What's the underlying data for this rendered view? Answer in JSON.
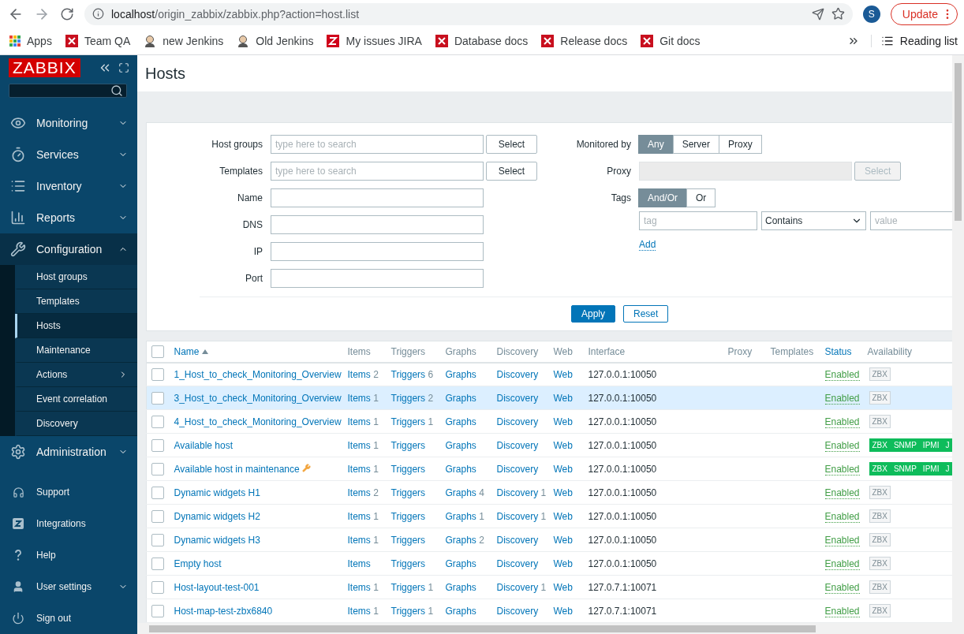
{
  "browser": {
    "url_host": "localhost",
    "url_path": "/origin_zabbix/zabbix.php?action=host.list",
    "profile": "S",
    "update": "Update",
    "bookmarks": [
      {
        "label": "Apps",
        "kind": "apps"
      },
      {
        "label": "Team QA",
        "kind": "doc"
      },
      {
        "label": "new Jenkins",
        "kind": "person"
      },
      {
        "label": "Old Jenkins",
        "kind": "person"
      },
      {
        "label": "My issues JIRA",
        "kind": "jira"
      },
      {
        "label": "Database docs",
        "kind": "doc"
      },
      {
        "label": "Release docs",
        "kind": "doc"
      },
      {
        "label": "Git docs",
        "kind": "doc"
      }
    ],
    "reading_list": "Reading list"
  },
  "sidebar": {
    "logo": "ZABBIX",
    "menu": [
      {
        "label": "Monitoring",
        "expanded": false
      },
      {
        "label": "Services",
        "expanded": false
      },
      {
        "label": "Inventory",
        "expanded": false
      },
      {
        "label": "Reports",
        "expanded": false
      },
      {
        "label": "Configuration",
        "expanded": true,
        "children": [
          {
            "label": "Host groups",
            "selected": false
          },
          {
            "label": "Templates",
            "selected": false
          },
          {
            "label": "Hosts",
            "selected": true
          },
          {
            "label": "Maintenance",
            "selected": false
          },
          {
            "label": "Actions",
            "selected": false,
            "expanded": false
          },
          {
            "label": "Event correlation",
            "selected": false
          },
          {
            "label": "Discovery",
            "selected": false
          }
        ]
      },
      {
        "label": "Administration",
        "expanded": false
      }
    ],
    "footer": [
      {
        "label": "Support"
      },
      {
        "label": "Integrations"
      },
      {
        "label": "Help"
      },
      {
        "label": "User settings",
        "expanded": false
      },
      {
        "label": "Sign out"
      }
    ]
  },
  "page": {
    "title": "Hosts"
  },
  "filter": {
    "fields": [
      {
        "label": "Host groups",
        "kind": "multiselect",
        "placeholder": "type here to search",
        "button": "Select"
      },
      {
        "label": "Templates",
        "kind": "multiselect",
        "placeholder": "type here to search",
        "button": "Select"
      },
      {
        "label": "Name",
        "kind": "text"
      },
      {
        "label": "DNS",
        "kind": "text"
      },
      {
        "label": "IP",
        "kind": "text"
      },
      {
        "label": "Port",
        "kind": "text"
      }
    ],
    "monitored_by": {
      "label": "Monitored by",
      "options": [
        {
          "label": "Any",
          "selected": true
        },
        {
          "label": "Server",
          "selected": false
        },
        {
          "label": "Proxy",
          "selected": false
        }
      ]
    },
    "proxy": {
      "label": "Proxy",
      "button": "Select",
      "disabled": true
    },
    "tags": {
      "label": "Tags",
      "options": [
        {
          "label": "And/Or",
          "selected": true
        },
        {
          "label": "Or",
          "selected": false
        }
      ],
      "tag_placeholder": "tag",
      "operator": "Contains",
      "value_placeholder": "value",
      "add": "Add"
    },
    "apply": "Apply",
    "reset": "Reset"
  },
  "table": {
    "select_all": {
      "checked": false
    },
    "columns": [
      {
        "label": "Name",
        "sortable": true,
        "sorted": true
      },
      {
        "label": "Items",
        "sortable": false
      },
      {
        "label": "Triggers",
        "sortable": false
      },
      {
        "label": "Graphs",
        "sortable": false
      },
      {
        "label": "Discovery",
        "sortable": false
      },
      {
        "label": "Web",
        "sortable": false
      },
      {
        "label": "Interface",
        "sortable": false
      },
      {
        "label": "Proxy",
        "sortable": false
      },
      {
        "label": "Templates",
        "sortable": false
      },
      {
        "label": "Status",
        "sortable": true
      },
      {
        "label": "Availability",
        "sortable": false
      }
    ],
    "rows": [
      {
        "checked": false,
        "hovered": false,
        "name": "1_Host_to_check_Monitoring_Overview",
        "maintenance": false,
        "items": {
          "label": "Items",
          "count": "2"
        },
        "triggers": {
          "label": "Triggers",
          "count": "6"
        },
        "graphs": {
          "label": "Graphs"
        },
        "discovery": {
          "label": "Discovery"
        },
        "web": "Web",
        "interface": "127.0.0.1:10050",
        "status": "Enabled",
        "availability": [
          {
            "label": "ZBX",
            "available": false
          }
        ]
      },
      {
        "checked": false,
        "hovered": true,
        "name": "3_Host_to_check_Monitoring_Overview",
        "maintenance": false,
        "items": {
          "label": "Items",
          "count": "1"
        },
        "triggers": {
          "label": "Triggers",
          "count": "2"
        },
        "graphs": {
          "label": "Graphs"
        },
        "discovery": {
          "label": "Discovery"
        },
        "web": "Web",
        "interface": "127.0.0.1:10050",
        "status": "Enabled",
        "availability": [
          {
            "label": "ZBX",
            "available": false
          }
        ]
      },
      {
        "checked": false,
        "hovered": false,
        "name": "4_Host_to_check_Monitoring_Overview",
        "maintenance": false,
        "items": {
          "label": "Items",
          "count": "1"
        },
        "triggers": {
          "label": "Triggers",
          "count": "1"
        },
        "graphs": {
          "label": "Graphs"
        },
        "discovery": {
          "label": "Discovery"
        },
        "web": "Web",
        "interface": "127.0.0.1:10050",
        "status": "Enabled",
        "availability": [
          {
            "label": "ZBX",
            "available": false
          }
        ]
      },
      {
        "checked": false,
        "hovered": false,
        "name": "Available host",
        "maintenance": false,
        "items": {
          "label": "Items",
          "count": "1"
        },
        "triggers": {
          "label": "Triggers"
        },
        "graphs": {
          "label": "Graphs"
        },
        "discovery": {
          "label": "Discovery"
        },
        "web": "Web",
        "interface": "127.0.0.1:10050",
        "status": "Enabled",
        "availability": [
          {
            "label": "ZBX",
            "available": true
          },
          {
            "label": "SNMP",
            "available": true
          },
          {
            "label": "IPMI",
            "available": true
          },
          {
            "label": "J",
            "available": true
          }
        ]
      },
      {
        "checked": false,
        "hovered": false,
        "name": "Available host in maintenance",
        "maintenance": true,
        "items": {
          "label": "Items",
          "count": "1"
        },
        "triggers": {
          "label": "Triggers"
        },
        "graphs": {
          "label": "Graphs"
        },
        "discovery": {
          "label": "Discovery"
        },
        "web": "Web",
        "interface": "127.0.0.1:10050",
        "status": "Enabled",
        "availability": [
          {
            "label": "ZBX",
            "available": true
          },
          {
            "label": "SNMP",
            "available": true
          },
          {
            "label": "IPMI",
            "available": true
          },
          {
            "label": "J",
            "available": true
          }
        ]
      },
      {
        "checked": false,
        "hovered": false,
        "name": "Dynamic widgets H1",
        "maintenance": false,
        "items": {
          "label": "Items",
          "count": "2"
        },
        "triggers": {
          "label": "Triggers"
        },
        "graphs": {
          "label": "Graphs",
          "count": "4"
        },
        "discovery": {
          "label": "Discovery",
          "count": "1"
        },
        "web": "Web",
        "interface": "127.0.0.1:10050",
        "status": "Enabled",
        "availability": [
          {
            "label": "ZBX",
            "available": false
          }
        ]
      },
      {
        "checked": false,
        "hovered": false,
        "name": "Dynamic widgets H2",
        "maintenance": false,
        "items": {
          "label": "Items",
          "count": "1"
        },
        "triggers": {
          "label": "Triggers"
        },
        "graphs": {
          "label": "Graphs",
          "count": "1"
        },
        "discovery": {
          "label": "Discovery",
          "count": "1"
        },
        "web": "Web",
        "interface": "127.0.0.1:10050",
        "status": "Enabled",
        "availability": [
          {
            "label": "ZBX",
            "available": false
          }
        ]
      },
      {
        "checked": false,
        "hovered": false,
        "name": "Dynamic widgets H3",
        "maintenance": false,
        "items": {
          "label": "Items",
          "count": "1"
        },
        "triggers": {
          "label": "Triggers"
        },
        "graphs": {
          "label": "Graphs",
          "count": "2"
        },
        "discovery": {
          "label": "Discovery"
        },
        "web": "Web",
        "interface": "127.0.0.1:10050",
        "status": "Enabled",
        "availability": [
          {
            "label": "ZBX",
            "available": false
          }
        ]
      },
      {
        "checked": false,
        "hovered": false,
        "name": "Empty host",
        "maintenance": false,
        "items": {
          "label": "Items"
        },
        "triggers": {
          "label": "Triggers"
        },
        "graphs": {
          "label": "Graphs"
        },
        "discovery": {
          "label": "Discovery"
        },
        "web": "Web",
        "interface": "127.0.0.1:10050",
        "status": "Enabled",
        "availability": [
          {
            "label": "ZBX",
            "available": false
          }
        ]
      },
      {
        "checked": false,
        "hovered": false,
        "name": "Host-layout-test-001",
        "maintenance": false,
        "items": {
          "label": "Items",
          "count": "1"
        },
        "triggers": {
          "label": "Triggers",
          "count": "1"
        },
        "graphs": {
          "label": "Graphs"
        },
        "discovery": {
          "label": "Discovery",
          "count": "1"
        },
        "web": "Web",
        "interface": "127.0.7.1:10071",
        "status": "Enabled",
        "availability": [
          {
            "label": "ZBX",
            "available": false
          }
        ]
      },
      {
        "checked": false,
        "hovered": false,
        "name": "Host-map-test-zbx6840",
        "maintenance": false,
        "items": {
          "label": "Items",
          "count": "1"
        },
        "triggers": {
          "label": "Triggers",
          "count": "1"
        },
        "graphs": {
          "label": "Graphs"
        },
        "discovery": {
          "label": "Discovery"
        },
        "web": "Web",
        "interface": "127.0.7.1:10071",
        "status": "Enabled",
        "availability": [
          {
            "label": "ZBX",
            "available": false
          }
        ]
      }
    ]
  }
}
